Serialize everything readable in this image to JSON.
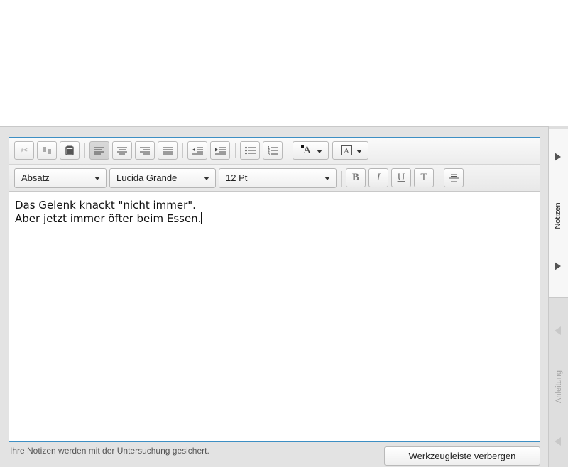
{
  "editor": {
    "toolbar1": {
      "icons": [
        "cut-icon",
        "copy-icon",
        "paste-icon",
        "align-left-icon",
        "align-center-icon",
        "align-right-icon",
        "align-justify-icon",
        "outdent-icon",
        "indent-icon",
        "bullet-list-icon",
        "numbered-list-icon",
        "text-color-icon",
        "background-color-icon"
      ],
      "text_color_glyph": "A"
    },
    "toolbar2": {
      "paragraph_style": "Absatz",
      "font_family": "Lucida Grande",
      "font_size": "12 Pt",
      "bold_label": "B",
      "italic_label": "I",
      "underline_label": "U",
      "strike_label": "T"
    },
    "content": {
      "line1": "Das Gelenk knackt \"nicht immer\".",
      "line2": "Aber jetzt immer öfter beim Essen."
    }
  },
  "footer": {
    "note": "Ihre Notizen werden mit der Untersuchung gesichert.",
    "hide_toolbar_label": "Werkzeugleiste verbergen"
  },
  "side_panel": {
    "notes_tab": "Notizen",
    "guide_tab": "Anleitung"
  },
  "colors": {
    "focus_border": "#3d8fc4",
    "panel_bg": "#e3e3e3"
  }
}
